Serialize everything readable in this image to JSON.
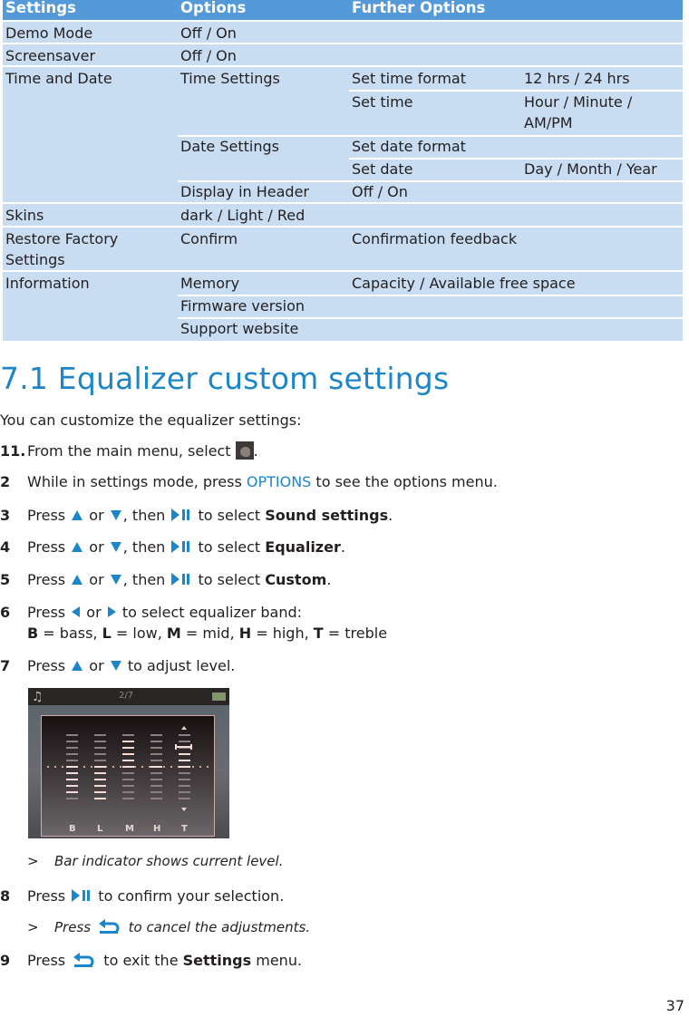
{
  "settings_table": {
    "headers": [
      "Settings",
      "Options",
      "Further Options"
    ],
    "rows": [
      {
        "setting": "Demo Mode",
        "option": "Off / On",
        "further": "",
        "value": ""
      },
      {
        "setting": "Screensaver",
        "option": "Off / On",
        "further": "",
        "value": ""
      },
      {
        "setting": "Time and Date",
        "option": "Time Settings",
        "further": "Set time format",
        "value": "12 hrs / 24 hrs"
      },
      {
        "setting": "",
        "option": "",
        "further": "Set time",
        "value": "Hour / Minute /",
        "value_line2": "AM/PM"
      },
      {
        "setting": "",
        "option": "Date Settings",
        "further": "Set date format",
        "value": ""
      },
      {
        "setting": "",
        "option": "",
        "further": "Set date",
        "value": "Day / Month / Year"
      },
      {
        "setting": "",
        "option": "Display in Header",
        "further": "Off / On",
        "value": ""
      },
      {
        "setting": "Skins",
        "option": "dark / Light / Red",
        "further": "",
        "value": ""
      },
      {
        "setting": "Restore Factory",
        "setting_line2": "Settings",
        "option": "Confirm",
        "further": "Confirmation feedback",
        "value": ""
      },
      {
        "setting": "Information",
        "option": "Memory",
        "further": "Capacity / Available free space",
        "value": ""
      },
      {
        "setting": "",
        "option": "Firmware version",
        "further": "",
        "value": ""
      },
      {
        "setting": "",
        "option": "Support website",
        "further": "",
        "value": ""
      }
    ]
  },
  "section": {
    "title": "7.1  Equalizer custom settings",
    "intro": "You can customize the equalizer settings:",
    "steps": [
      {
        "num": "11.",
        "parts": {
          "a": "From the main menu, select ",
          "b": "."
        }
      },
      {
        "num": "2",
        "parts": {
          "a": "While in settings mode, press ",
          "link": "OPTIONS",
          "b": " to see the options menu."
        }
      },
      {
        "num": "3",
        "parts": {
          "a": "Press ",
          "or": " or ",
          "then": ", then ",
          "sel": " to select ",
          "bold": "Sound settings",
          "end": "."
        }
      },
      {
        "num": "4",
        "parts": {
          "a": "Press ",
          "or": " or ",
          "then": ", then ",
          "sel": " to select ",
          "bold": "Equalizer",
          "end": "."
        }
      },
      {
        "num": "5",
        "parts": {
          "a": "Press ",
          "or": " or ",
          "then": ", then ",
          "sel": " to select ",
          "bold": "Custom",
          "end": "."
        }
      },
      {
        "num": "6",
        "parts": {
          "a": "Press ",
          "or": " or ",
          "b": " to select equalizer band:"
        },
        "legend": [
          {
            "key": "B",
            "value": " = bass, "
          },
          {
            "key": "L",
            "value": " = low, "
          },
          {
            "key": "M",
            "value": " = mid, "
          },
          {
            "key": "H",
            "value": " = high, "
          },
          {
            "key": "T",
            "value": " = treble"
          }
        ]
      },
      {
        "num": "7",
        "parts": {
          "a": "Press ",
          "or": " or ",
          "b": " to adjust level."
        }
      },
      {
        "num": "8",
        "parts": {
          "a": "Press ",
          "b": " to confirm your selection."
        }
      },
      {
        "num": "9",
        "parts": {
          "a": "Press ",
          "b": " to exit the ",
          "bold": "Settings",
          "end": " menu."
        }
      }
    ],
    "notes": [
      {
        "gt": ">",
        "text": "Bar indicator shows current level."
      },
      {
        "gt": ">",
        "a": "Press ",
        "b": " to cancel the adjustments."
      }
    ]
  },
  "device_screen": {
    "track_counter": "2/7",
    "icons": {
      "top_left": "music-note-icon",
      "top_right": "battery-icon"
    },
    "equalizer": {
      "segments_per_band": 11,
      "selected_band": "T",
      "bands": [
        {
          "label": "B",
          "level": -4
        },
        {
          "label": "L",
          "level": -5
        },
        {
          "label": "M",
          "level": 4
        },
        {
          "label": "H",
          "level": 0
        },
        {
          "label": "T",
          "level": 3
        }
      ]
    }
  },
  "colors": {
    "accent": "#1c86c8",
    "table_header": "#559ad8",
    "table_row": "#c9ddf2"
  },
  "page_number": "37"
}
